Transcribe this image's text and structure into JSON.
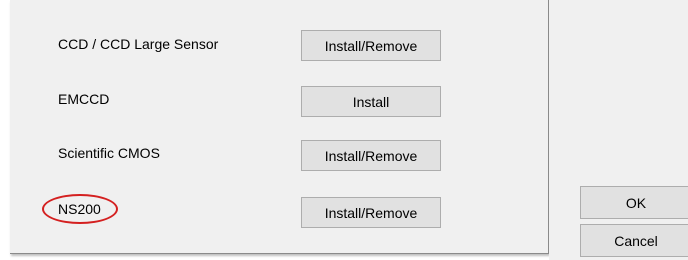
{
  "options": [
    {
      "label": "CCD / CCD Large Sensor",
      "button": "Install/Remove"
    },
    {
      "label": "EMCCD",
      "button": "Install"
    },
    {
      "label": "Scientific CMOS",
      "button": "Install/Remove"
    },
    {
      "label": "NS200",
      "button": "Install/Remove"
    }
  ],
  "dialog": {
    "ok_label": "OK",
    "cancel_label": "Cancel"
  },
  "colors": {
    "panel_background": "#f0f0f0",
    "button_background": "#e1e1e1",
    "highlight_ring": "#d42020"
  }
}
